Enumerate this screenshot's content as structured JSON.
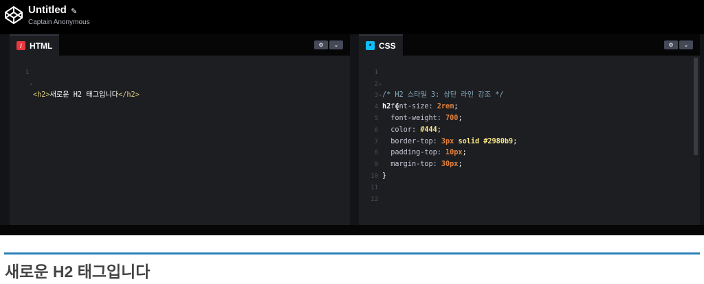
{
  "header": {
    "title": "Untitled",
    "author": "Captain Anonymous"
  },
  "html_editor": {
    "tab_label": "HTML",
    "lines": [
      {
        "n": "1",
        "tag_open": "<h2>",
        "text": "새로운 H2 태그입니다",
        "tag_close": "</h2>"
      }
    ]
  },
  "css_editor": {
    "tab_label": "CSS",
    "line_numbers": [
      "1",
      "2",
      "3",
      "4",
      "5",
      "6",
      "7",
      "8",
      "9",
      "10",
      "11",
      "12"
    ],
    "comment": "/* H2 스타일 3: 상단 라인 강조 */",
    "selector": "h2 {",
    "declarations": [
      {
        "prop": "font-size:",
        "value": "2rem",
        "end": ";"
      },
      {
        "prop": "font-weight:",
        "value": "700",
        "end": ";"
      },
      {
        "prop": "color:",
        "value": "#444",
        "end": ";"
      },
      {
        "prop": "border-top:",
        "value": "3px",
        "value2": "solid",
        "value3": "#2980b9",
        "end": ";"
      },
      {
        "prop": "padding-top:",
        "value": "10px",
        "end": ";"
      },
      {
        "prop": "margin-top:",
        "value": "30px",
        "end": ";"
      }
    ],
    "close": "}"
  },
  "preview": {
    "heading": "새로운 H2 태그입니다",
    "border_color": "#2980b9"
  },
  "colors": {
    "html_icon": "#e8383d",
    "css_icon": "#0ebeff"
  }
}
